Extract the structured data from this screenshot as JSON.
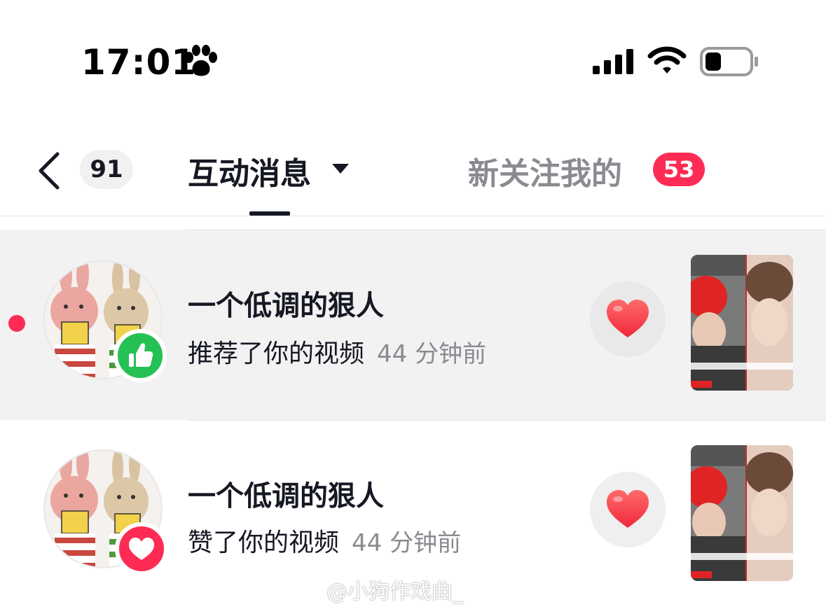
{
  "status_bar": {
    "time": "17:01"
  },
  "header": {
    "back_count": "91",
    "tab_active": "互动消息",
    "tab_inactive": "新关注我的",
    "tab_inactive_badge": "53"
  },
  "notifications": [
    {
      "name": "一个低调的狠人",
      "action": "推荐了你的视频",
      "time": "44 分钟前",
      "unread": true,
      "badge_icon": "thumbs-up-icon"
    },
    {
      "name": "一个低调的狠人",
      "action": "赞了你的视频",
      "time": "44 分钟前",
      "unread": false,
      "badge_icon": "heart-icon"
    }
  ],
  "watermark": "@小狗作戏曲_",
  "colors": {
    "accent": "#fe2c55",
    "like_green": "#25c155",
    "unread_bg": "#f2f2f3",
    "muted_text": "#8a8b91"
  }
}
